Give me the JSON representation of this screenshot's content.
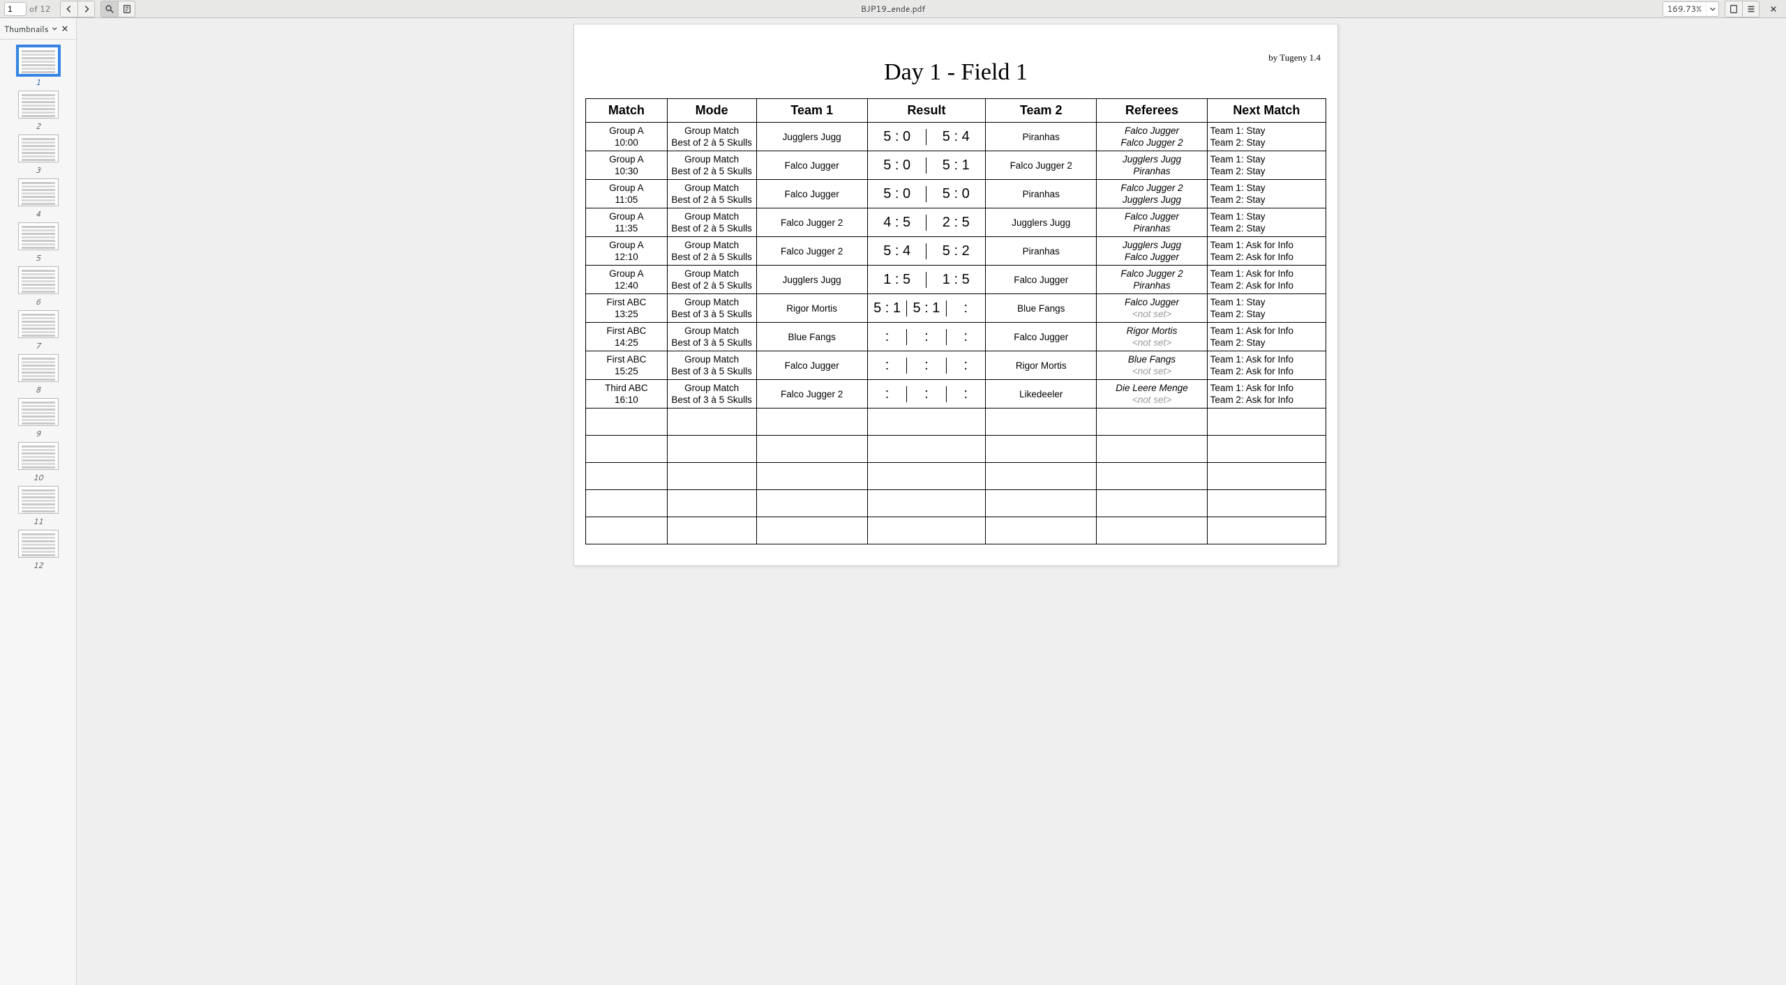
{
  "toolbar": {
    "page_current": "1",
    "page_total_label": "of 12",
    "filename": "BJP19_ende.pdf",
    "zoom": "169.73%"
  },
  "thumbnails": {
    "title": "Thumbnails",
    "count": 12,
    "selected": 1
  },
  "document": {
    "byline": "by Tugeny 1.4",
    "title": "Day 1 - Field 1",
    "columns": [
      "Match",
      "Mode",
      "Team 1",
      "Result",
      "Team 2",
      "Referees",
      "Next Match"
    ],
    "rows": [
      {
        "match": [
          "Group A",
          "10:00"
        ],
        "mode": [
          "Group Match",
          "Best of 2 à 5 Skulls"
        ],
        "team1": "Jugglers Jugg",
        "results": [
          "5 : 0",
          "5 : 4"
        ],
        "team2": "Piranhas",
        "referees": [
          "Falco Jugger",
          "Falco Jugger 2"
        ],
        "next": [
          "Team 1: Stay",
          "Team 2: Stay"
        ]
      },
      {
        "match": [
          "Group A",
          "10:30"
        ],
        "mode": [
          "Group Match",
          "Best of 2 à 5 Skulls"
        ],
        "team1": "Falco Jugger",
        "results": [
          "5 : 0",
          "5 : 1"
        ],
        "team2": "Falco Jugger 2",
        "referees": [
          "Jugglers Jugg",
          "Piranhas"
        ],
        "next": [
          "Team 1: Stay",
          "Team 2: Stay"
        ]
      },
      {
        "match": [
          "Group A",
          "11:05"
        ],
        "mode": [
          "Group Match",
          "Best of 2 à 5 Skulls"
        ],
        "team1": "Falco Jugger",
        "results": [
          "5 : 0",
          "5 : 0"
        ],
        "team2": "Piranhas",
        "referees": [
          "Falco Jugger 2",
          "Jugglers Jugg"
        ],
        "next": [
          "Team 1: Stay",
          "Team 2: Stay"
        ]
      },
      {
        "match": [
          "Group A",
          "11:35"
        ],
        "mode": [
          "Group Match",
          "Best of 2 à 5 Skulls"
        ],
        "team1": "Falco Jugger 2",
        "results": [
          "4 : 5",
          "2 : 5"
        ],
        "team2": "Jugglers Jugg",
        "referees": [
          "Falco Jugger",
          "Piranhas"
        ],
        "next": [
          "Team 1: Stay",
          "Team 2: Stay"
        ]
      },
      {
        "match": [
          "Group A",
          "12:10"
        ],
        "mode": [
          "Group Match",
          "Best of 2 à 5 Skulls"
        ],
        "team1": "Falco Jugger 2",
        "results": [
          "5 : 4",
          "5 : 2"
        ],
        "team2": "Piranhas",
        "referees": [
          "Jugglers Jugg",
          "Falco Jugger"
        ],
        "next": [
          "Team 1: Ask for Info",
          "Team 2: Ask for Info"
        ]
      },
      {
        "match": [
          "Group A",
          "12:40"
        ],
        "mode": [
          "Group Match",
          "Best of 2 à 5 Skulls"
        ],
        "team1": "Jugglers Jugg",
        "results": [
          "1 : 5",
          "1 : 5"
        ],
        "team2": "Falco Jugger",
        "referees": [
          "Falco Jugger 2",
          "Piranhas"
        ],
        "next": [
          "Team 1: Ask for Info",
          "Team 2: Ask for Info"
        ]
      },
      {
        "match": [
          "First ABC",
          "13:25"
        ],
        "mode": [
          "Group Match",
          "Best of 3 à 5 Skulls"
        ],
        "team1": "Rigor Mortis",
        "results": [
          "5 : 1",
          "5 : 1",
          ":"
        ],
        "team2": "Blue Fangs",
        "referees": [
          "Falco Jugger",
          "<not set>"
        ],
        "next": [
          "Team 1: Stay",
          "Team 2: Stay"
        ]
      },
      {
        "match": [
          "First ABC",
          "14:25"
        ],
        "mode": [
          "Group Match",
          "Best of 3 à 5 Skulls"
        ],
        "team1": "Blue Fangs",
        "results": [
          ":",
          ":",
          ":"
        ],
        "team2": "Falco Jugger",
        "referees": [
          "Rigor Mortis",
          "<not set>"
        ],
        "next": [
          "Team 1: Ask for Info",
          "Team 2: Stay"
        ]
      },
      {
        "match": [
          "First ABC",
          "15:25"
        ],
        "mode": [
          "Group Match",
          "Best of 3 à 5 Skulls"
        ],
        "team1": "Falco Jugger",
        "results": [
          ":",
          ":",
          ":"
        ],
        "team2": "Rigor Mortis",
        "referees": [
          "Blue Fangs",
          "<not set>"
        ],
        "next": [
          "Team 1: Ask for Info",
          "Team 2: Ask for Info"
        ]
      },
      {
        "match": [
          "Third ABC",
          "16:10"
        ],
        "mode": [
          "Group Match",
          "Best of 3 à 5 Skulls"
        ],
        "team1": "Falco Jugger 2",
        "results": [
          ":",
          ":",
          ":"
        ],
        "team2": "Likedeeler",
        "referees": [
          "Die Leere Menge",
          "<not set>"
        ],
        "next": [
          "Team 1: Ask for Info",
          "Team 2: Ask for Info"
        ]
      }
    ],
    "empty_rows": 5
  }
}
